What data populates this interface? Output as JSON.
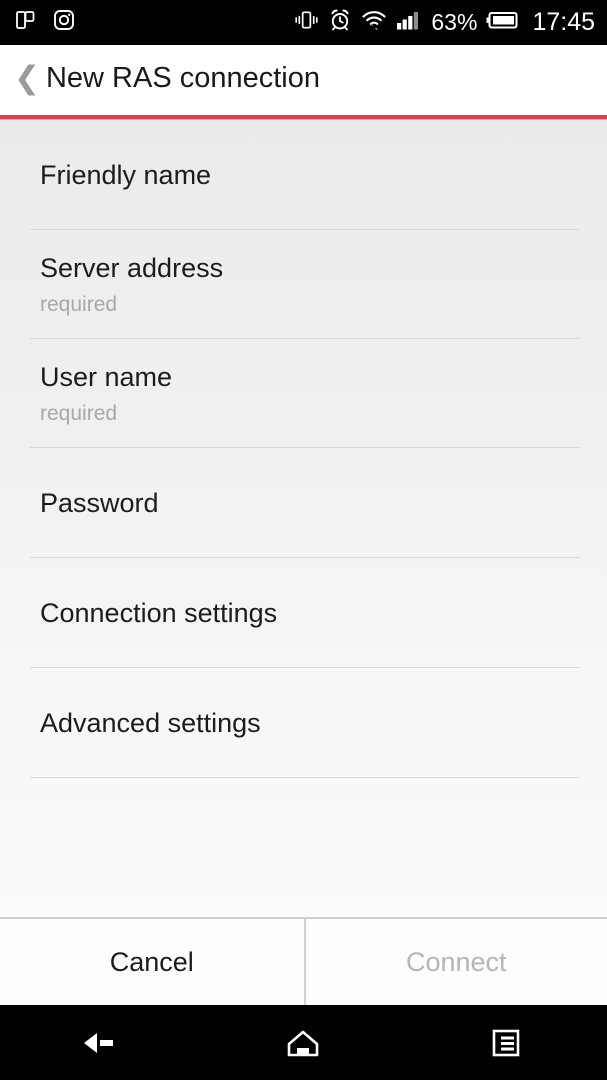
{
  "status_bar": {
    "left_icons": [
      {
        "name": "flipboard-icon",
        "label": "Flipboard notification"
      },
      {
        "name": "instagram-camera-icon",
        "label": "Instagram notification"
      }
    ],
    "right_icons": [
      {
        "name": "vibrate-icon",
        "label": "Vibrate mode"
      },
      {
        "name": "alarm-clock-icon",
        "label": "Alarm set"
      },
      {
        "name": "wifi-icon",
        "label": "Wi-Fi connected with data activity"
      },
      {
        "name": "signal-bars-icon",
        "label": "Mobile signal"
      }
    ],
    "battery_percent": "63%",
    "battery_icon": "battery-icon",
    "clock": "17:45"
  },
  "title_bar": {
    "back_icon": "back-chevron-icon",
    "title": "New RAS connection",
    "accent_color": "#e8384f"
  },
  "form": {
    "fields": [
      {
        "label": "Friendly name",
        "hint": ""
      },
      {
        "label": "Server address",
        "hint": "required"
      },
      {
        "label": "User name",
        "hint": "required"
      },
      {
        "label": "Password",
        "hint": ""
      },
      {
        "label": "Connection settings",
        "hint": ""
      },
      {
        "label": "Advanced settings",
        "hint": ""
      }
    ]
  },
  "buttons": {
    "cancel": "Cancel",
    "connect": "Connect",
    "connect_disabled": true
  },
  "nav_bar": {
    "back": "back-nav-icon",
    "home": "home-nav-icon",
    "recents": "recents-nav-icon"
  }
}
